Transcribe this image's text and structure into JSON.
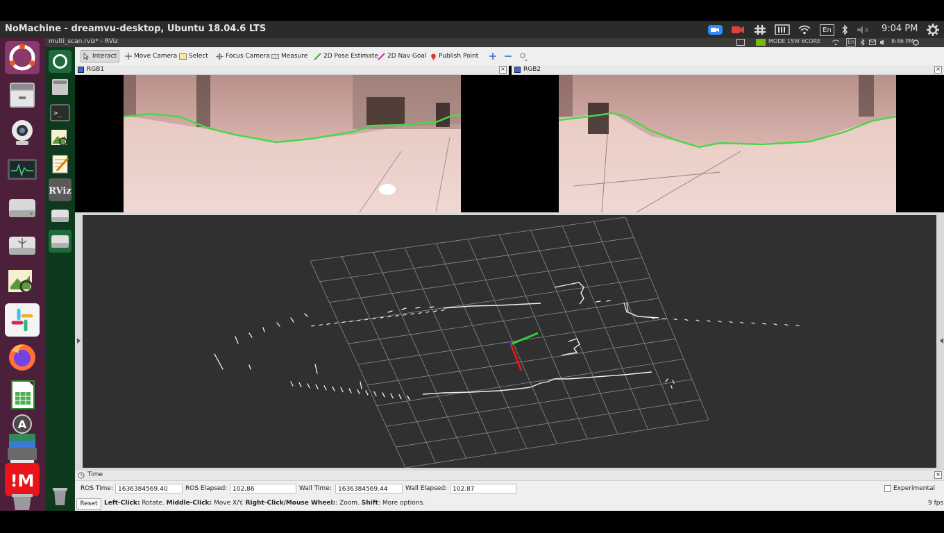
{
  "window": {
    "title": "NoMachine - dreamvu-desktop, Ubuntu 18.04.6 LTS",
    "clock": "9:04 PM",
    "keyboard": "En"
  },
  "inner_panel": {
    "title": "multi_scan.rviz* - RViz",
    "mode": "MODE 15W 6CORE",
    "keyboard": "En",
    "clock": "8:46 PM"
  },
  "toolbar": {
    "tools": [
      "Interact",
      "Move Camera",
      "Select",
      "Focus Camera",
      "Measure",
      "2D Pose Estimate",
      "2D Nav Goal",
      "Publish Point"
    ]
  },
  "panels": {
    "rgb1": "RGB1",
    "rgb2": "RGB2",
    "close": "×"
  },
  "time_panel": {
    "title": "Time",
    "ros_time_label": "ROS Time:",
    "ros_time": "1636384569.40",
    "ros_elapsed_label": "ROS Elapsed:",
    "ros_elapsed": "102.86",
    "wall_time_label": "Wall Time:",
    "wall_time": "1636384569.44",
    "wall_elapsed_label": "Wall Elapsed:",
    "wall_elapsed": "102.87",
    "experimental": "Experimental"
  },
  "status": {
    "reset": "Reset",
    "left_click": "Left-Click:",
    "left_click_desc": " Rotate. ",
    "middle_click": "Middle-Click:",
    "middle_click_desc": " Move X/Y. ",
    "right_click": "Right-Click/Mouse Wheel:",
    "right_click_desc": ": Zoom. ",
    "shift": "Shift",
    "shift_desc": ": More options.",
    "fps": "9 fps"
  },
  "colors": {
    "launcher": "#4c1f3b",
    "viewport": "#303030",
    "floor_line": "#4cd64a",
    "axis_x": "#e01818",
    "axis_y": "#30d030",
    "axis_z": "#2040ff"
  },
  "icons": [
    "ubuntu-icon",
    "files-icon",
    "webcam-icon",
    "system-monitor-icon",
    "disk-icon",
    "usb-icon",
    "image-viewer-icon",
    "slack-icon",
    "firefox-icon",
    "spreadsheet-icon",
    "software-updater-icon",
    "scanner-icon",
    "nomachine-icon",
    "trash-icon"
  ]
}
